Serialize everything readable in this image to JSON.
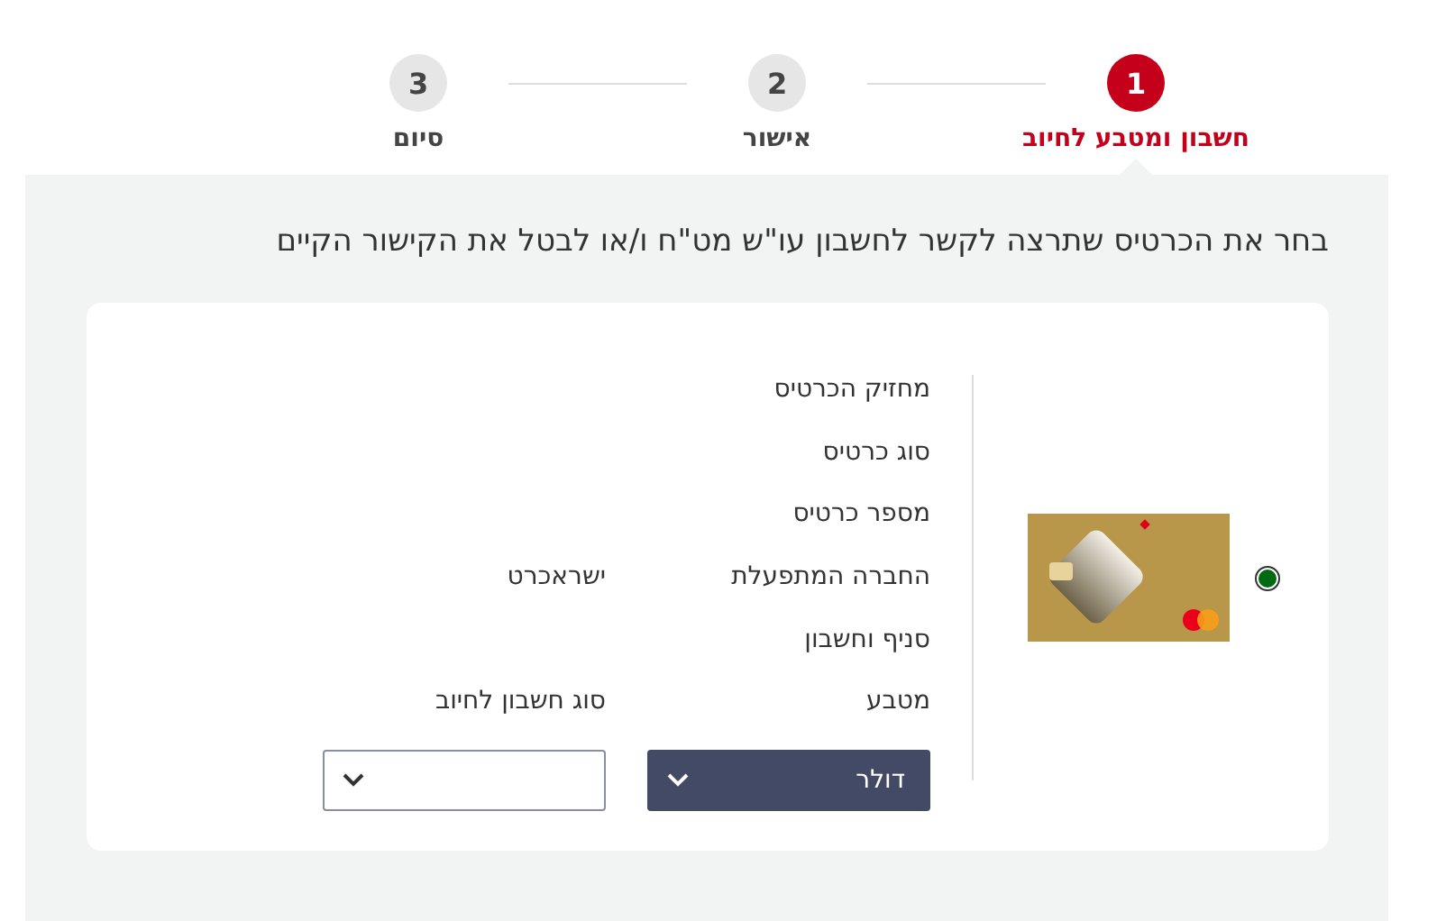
{
  "steps": [
    {
      "number": "1",
      "label": "חשבון ומטבע לחיוב",
      "selected": true
    },
    {
      "number": "2",
      "label": "אישור",
      "selected": false
    },
    {
      "number": "3",
      "label": "סיום",
      "selected": false
    }
  ],
  "title": "בחר את הכרטיס שתרצה לקשר לחשבון עו\"ש מט\"ח ו/או לבטל את הקישור הקיים",
  "card": {
    "selected": true,
    "details": [
      {
        "label": "מחזיק הכרטיס"
      },
      {
        "label": "סוג כרטיס"
      },
      {
        "label": "מספר כרטיס"
      },
      {
        "label": "החברה המתפעלת",
        "value": "ישראכרט"
      },
      {
        "label": "סניף וחשבון"
      }
    ],
    "selects": [
      {
        "label": "מטבע",
        "value": "דולר"
      },
      {
        "label": "סוג חשבון לחיוב"
      }
    ]
  }
}
